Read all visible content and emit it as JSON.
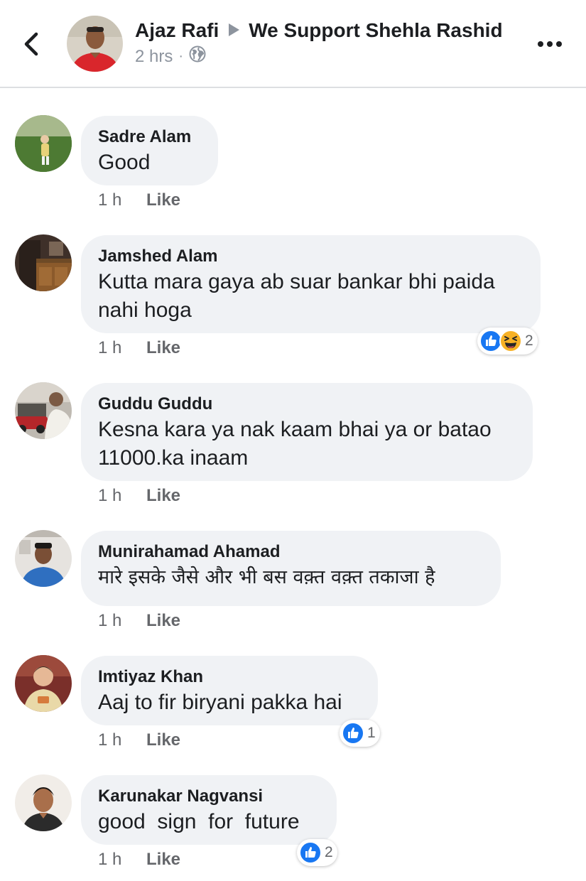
{
  "header": {
    "author": "Ajaz Rafi",
    "group": "We Support Shehla Rashid",
    "time": "2 hrs",
    "separator": "·",
    "privacy_icon": "globe-icon"
  },
  "comments": [
    {
      "author": "Sadre Alam",
      "text": "Good",
      "time": "1 h",
      "like_label": "Like"
    },
    {
      "author": "Jamshed Alam",
      "text": "Kutta mara gaya ab suar bankar bhi paida nahi hoga",
      "time": "1 h",
      "like_label": "Like",
      "reactions": {
        "types": [
          "like",
          "haha"
        ],
        "count": "2"
      }
    },
    {
      "author": "Guddu Guddu",
      "text": "Kesna kara ya nak kaam bhai ya or batao 11000.ka inaam",
      "time": "1 h",
      "like_label": "Like"
    },
    {
      "author": "Munirahamad Ahamad",
      "text": "मारे इसके जैसे और भी बस वक़्त वक़्त तकाजा है",
      "time": "1 h",
      "like_label": "Like"
    },
    {
      "author": "Imtiyaz Khan",
      "text": "Aaj to fir biryani pakka hai",
      "time": "1 h",
      "like_label": "Like",
      "reactions": {
        "types": [
          "like"
        ],
        "count": "1"
      }
    },
    {
      "author": "Karunakar Nagvansi",
      "text": "good  sign  for  future",
      "time": "1 h",
      "like_label": "Like",
      "reactions": {
        "types": [
          "like"
        ],
        "count": "2"
      }
    }
  ],
  "colors": {
    "bubble_bg": "#f0f2f5",
    "like_blue": "#1877f2",
    "haha_yellow": "#f7b125",
    "meta_gray": "#65676b"
  }
}
